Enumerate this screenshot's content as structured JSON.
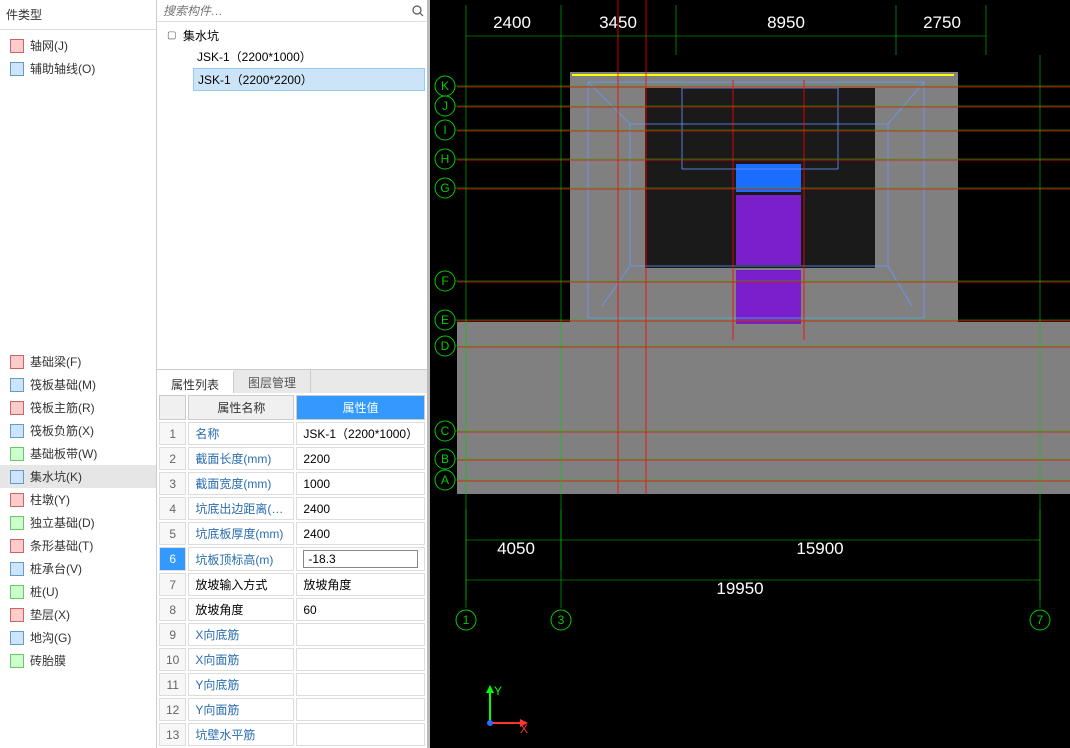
{
  "left": {
    "title": "件类型",
    "top_items": [
      {
        "label": "轴网(J)",
        "iconClass": "red"
      },
      {
        "label": "辅助轴线(O)",
        "iconClass": "blue"
      },
      {
        "label": "",
        "iconClass": ""
      }
    ],
    "items": [
      {
        "label": "基础梁(F)",
        "iconClass": "red"
      },
      {
        "label": "筏板基础(M)",
        "iconClass": "blue"
      },
      {
        "label": "筏板主筋(R)",
        "iconClass": "red"
      },
      {
        "label": "筏板负筋(X)",
        "iconClass": "blue"
      },
      {
        "label": "基础板带(W)",
        "iconClass": "green"
      },
      {
        "label": "集水坑(K)",
        "iconClass": "blue",
        "selected": true
      },
      {
        "label": "柱墩(Y)",
        "iconClass": "red"
      },
      {
        "label": "独立基础(D)",
        "iconClass": "green"
      },
      {
        "label": "条形基础(T)",
        "iconClass": "red"
      },
      {
        "label": "桩承台(V)",
        "iconClass": "blue"
      },
      {
        "label": "桩(U)",
        "iconClass": "green"
      },
      {
        "label": "垫层(X)",
        "iconClass": "red"
      },
      {
        "label": "地沟(G)",
        "iconClass": "blue"
      },
      {
        "label": "砖胎膜",
        "iconClass": "green"
      }
    ]
  },
  "middle": {
    "search_placeholder": "搜索构件…",
    "tree": {
      "root": "集水坑",
      "children": [
        {
          "label": "JSK-1（2200*1000）"
        },
        {
          "label": "JSK-1（2200*2200）",
          "selected": true
        }
      ]
    },
    "tabs": [
      "属性列表",
      "图层管理"
    ],
    "active_tab": 0,
    "columns": {
      "name": "属性名称",
      "value": "属性值"
    },
    "rows": [
      {
        "name": "名称",
        "value": "JSK-1（2200*1000）",
        "link": true
      },
      {
        "name": "截面长度(mm)",
        "value": "2200",
        "link": true
      },
      {
        "name": "截面宽度(mm)",
        "value": "1000",
        "link": true
      },
      {
        "name": "坑底出边距离(…",
        "value": "2400",
        "link": true
      },
      {
        "name": "坑底板厚度(mm)",
        "value": "2400",
        "link": true
      },
      {
        "name": "坑板顶标高(m)",
        "value": "-18.3",
        "link": true,
        "selected": true,
        "editing": true
      },
      {
        "name": "放坡输入方式",
        "value": "放坡角度",
        "link": false
      },
      {
        "name": "放坡角度",
        "value": "60",
        "link": false
      },
      {
        "name": "X向底筋",
        "value": "",
        "link": true
      },
      {
        "name": "X向面筋",
        "value": "",
        "link": true
      },
      {
        "name": "Y向底筋",
        "value": "",
        "link": true
      },
      {
        "name": "Y向面筋",
        "value": "",
        "link": true
      },
      {
        "name": "坑壁水平筋",
        "value": "",
        "link": true
      }
    ]
  },
  "canvas": {
    "dims_top": [
      "2400",
      "3450",
      "8950",
      "2750"
    ],
    "dims_bottom": [
      "4050",
      "15900"
    ],
    "dim_bottom_total": "19950",
    "grid_rows": [
      "K",
      "J",
      "I",
      "H",
      "G",
      "F",
      "E",
      "D",
      "C",
      "B",
      "A"
    ],
    "grid_cols": [
      "1",
      "3",
      "7"
    ],
    "axis": {
      "x": "X",
      "y": "Y"
    }
  }
}
